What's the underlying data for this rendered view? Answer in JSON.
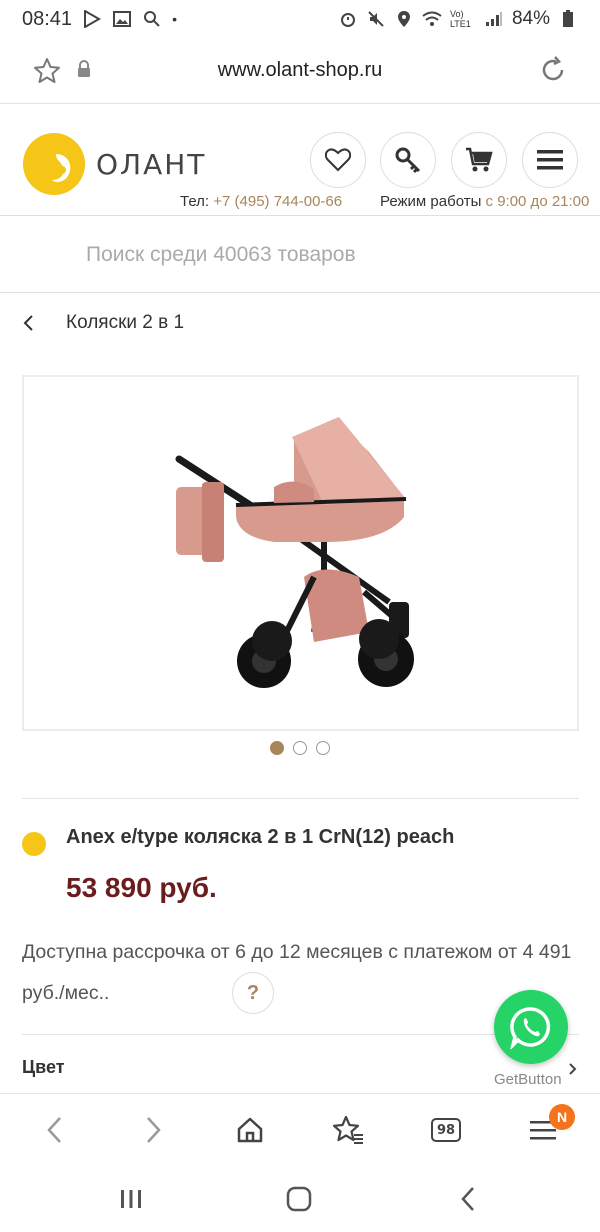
{
  "status_bar": {
    "time": "08:41",
    "battery": "84%",
    "network_label": "Vo) LTE1"
  },
  "url_bar": {
    "url": "www.olant-shop.ru"
  },
  "header": {
    "logo_text": "ОЛАНТ",
    "phone_label": "Тел:",
    "phone_number": "+7 (495) 744-00-66",
    "hours_label": "Режим работы",
    "hours_value": "с 9:00 до 21:00",
    "accent_color": "#a8865c",
    "logo_color": "#f5c518"
  },
  "search": {
    "placeholder": "Поиск среди 40063 товаров"
  },
  "breadcrumb": {
    "label": "Коляски 2 в 1"
  },
  "gallery": {
    "slide_count": 3,
    "active_index": 0
  },
  "product": {
    "title": "Anex e/type коляска 2 в 1 CrN(12) peach",
    "price": "53 890 руб.",
    "installment_text": "Доступна рассрочка от 6 до 12 месяцев с платежом от 4 491 руб./мес..",
    "help_symbol": "?",
    "color_label": "Цвет",
    "availability_color": "#f5c518",
    "price_color": "#6b1d1d"
  },
  "widget": {
    "getbutton_label": "GetButton",
    "whatsapp_color": "#25d366"
  },
  "browser_nav": {
    "tabs_count": "98",
    "menu_badge": "N"
  }
}
